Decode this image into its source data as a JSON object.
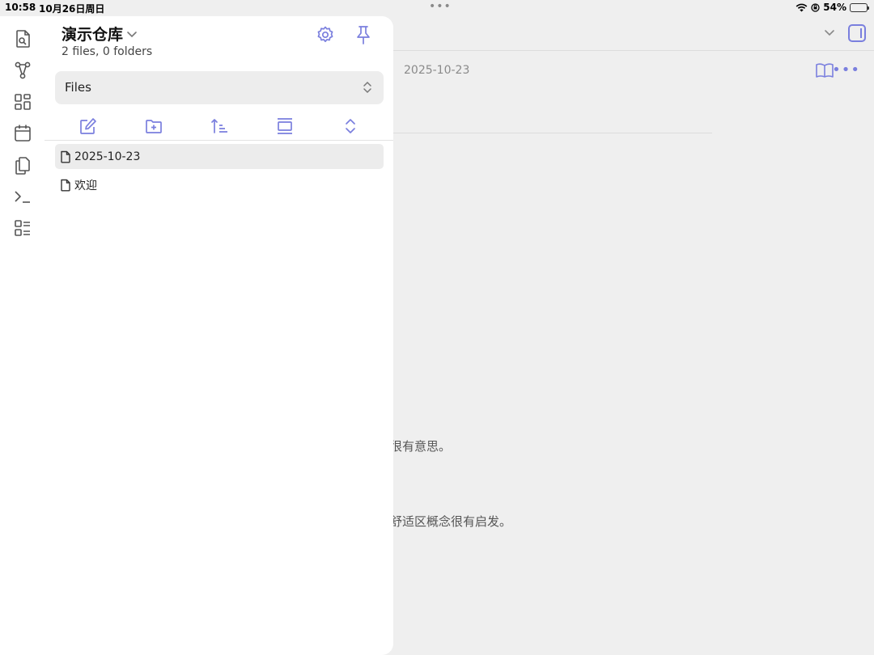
{
  "status_bar": {
    "time": "10:58",
    "date": "10月26日周日",
    "dots": "•••",
    "battery_text": "54%",
    "battery_level": 0.54
  },
  "editor": {
    "note_title": "2025-10-23",
    "more_label": "•••",
    "visible_lines": [
      "很有意思。",
      "舒适区概念很有启发。"
    ]
  },
  "drawer": {
    "vault_name": "演示仓库",
    "vault_meta": "2 files, 0 folders",
    "view_selector": {
      "selected": "Files"
    },
    "ribbon_icons": [
      "quick-switcher-icon",
      "graph-view-icon",
      "canvas-icon",
      "daily-note-icon",
      "templates-icon",
      "command-palette-icon",
      "bases-icon"
    ],
    "nav_icons": [
      "new-note-icon",
      "new-folder-icon",
      "sort-order-icon",
      "auto-reveal-icon",
      "collapse-all-icon"
    ],
    "files": [
      {
        "name": "2025-10-23",
        "active": true
      },
      {
        "name": "欢迎",
        "active": false
      }
    ]
  },
  "colors": {
    "accent": "#7a7fde",
    "drawer_bg": "#ffffff",
    "editor_bg": "#efefef",
    "active_row": "#ececec"
  }
}
